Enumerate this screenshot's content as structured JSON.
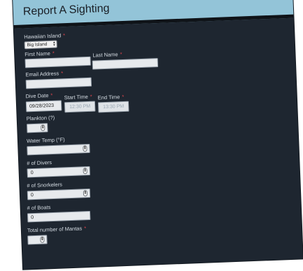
{
  "header": {
    "title": "Report A Sighting"
  },
  "form": {
    "island": {
      "label": "Hawaiian Island",
      "selected": "Big Island",
      "required": "*"
    },
    "first_name": {
      "label": "First Name",
      "value": "",
      "required": "*"
    },
    "last_name": {
      "label": "Last Name",
      "value": "",
      "required": "*"
    },
    "email": {
      "label": "Email Address",
      "value": "",
      "required": "*"
    },
    "dive_date": {
      "label": "Dive Date",
      "value": "09/28/2023",
      "required": "*"
    },
    "start_time": {
      "label": "Start Time",
      "placeholder": "12:30 PM",
      "required": "*"
    },
    "end_time": {
      "label": "End Time",
      "placeholder": "13:30 PM",
      "required": "*"
    },
    "plankton": {
      "label": "Plankton (?)",
      "value": ""
    },
    "water_temp": {
      "label": "Water Temp (°F)",
      "value": ""
    },
    "divers": {
      "label": "# of Divers",
      "value": "0"
    },
    "snorkelers": {
      "label": "# of Snorkelers",
      "value": "0"
    },
    "boats": {
      "label": "# of Boats",
      "value": "0"
    },
    "mantas": {
      "label": "Total number of Mantas",
      "value": "",
      "required": "*"
    }
  }
}
